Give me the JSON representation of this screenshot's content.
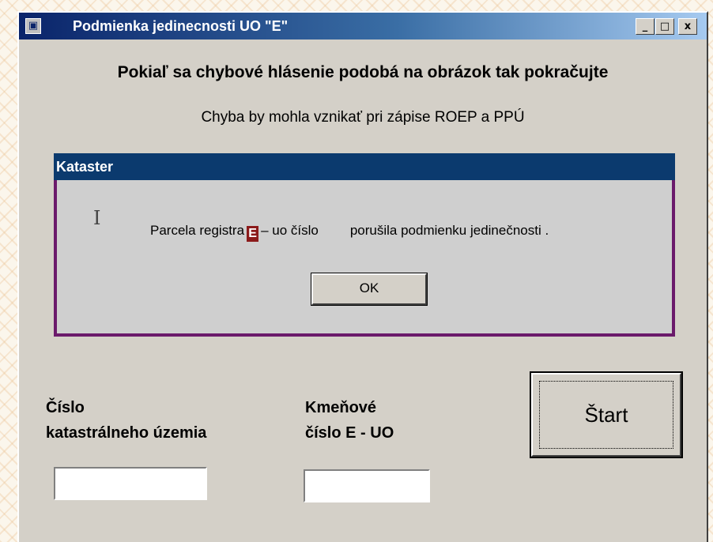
{
  "window": {
    "title": "Podmienka jedinecnosti UO \"E\"",
    "title_icon": "app-icon",
    "controls": {
      "minimize": "_",
      "maximize": "□",
      "close": "x"
    }
  },
  "main": {
    "heading": "Pokiaľ sa chybové hlásenie podobá na obrázok tak pokračujte",
    "subheading": "Chyba by mohla vznikať pri zápise ROEP a PPÚ"
  },
  "dialog": {
    "title": "Kataster",
    "message_before": "Parcela registra",
    "badge": "E",
    "message_middle": "– uo číslo",
    "message_after": "porušila podmienku jedinečnosti .",
    "ok_label": "OK"
  },
  "form": {
    "cislo_label_line1": "Číslo",
    "cislo_label_line2": "katastrálneho územia",
    "cislo_value": "",
    "kmen_label_line1": "Kmeňové",
    "kmen_label_line2": "číslo E - UO",
    "kmen_value": "",
    "start_label": "Štart"
  },
  "colors": {
    "window_bg": "#d4d0c8",
    "titlebar_start": "#0a246a",
    "titlebar_end": "#a6caf0",
    "dialog_title_bg": "#0b3a6e",
    "dialog_border": "#6b1a6b",
    "badge_bg": "#8b1a1a"
  }
}
